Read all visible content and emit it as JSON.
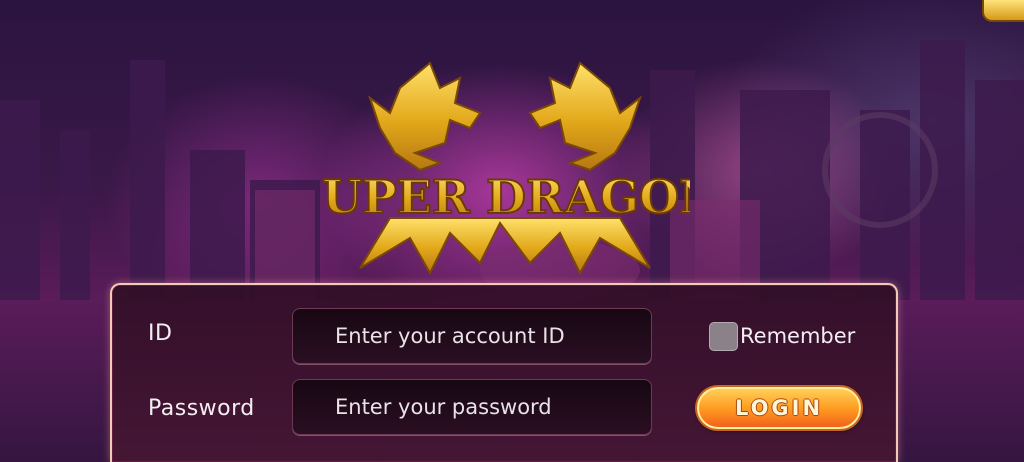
{
  "logo": {
    "text": "SUPER DRAGON"
  },
  "login_form": {
    "id_label": "ID",
    "id_placeholder": "Enter your account ID",
    "password_label": "Password",
    "password_placeholder": "Enter your password",
    "remember_label": "Remember",
    "remember_checked": false,
    "login_label": "LOGIN"
  },
  "colors": {
    "accent_gold": "#e8b81c",
    "login_orange": "#ff9d22",
    "panel_border": "#f3c9b9"
  }
}
